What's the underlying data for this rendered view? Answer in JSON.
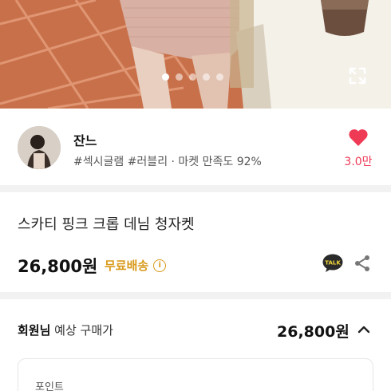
{
  "hero": {
    "slide_count": 5,
    "active_slide": 1,
    "expand_icon": "expand-icon"
  },
  "seller": {
    "name": "잔느",
    "meta": "#섹시글램 #러블리 · 마켓 만족도 92%",
    "like_count": "3.0만",
    "like_icon": "heart-icon",
    "accent_color": "#ef3a56"
  },
  "product": {
    "title": "스카티 핑크 크롭 데님 청자켓",
    "price": "26,800원",
    "shipping": "무료배송",
    "shipping_color": "#d99a1c",
    "talk_icon_text": "TALK"
  },
  "estimate": {
    "label_bold": "회원님",
    "label_rest": " 예상 구매가",
    "price": "26,800원"
  },
  "points": {
    "label": "포인트"
  }
}
